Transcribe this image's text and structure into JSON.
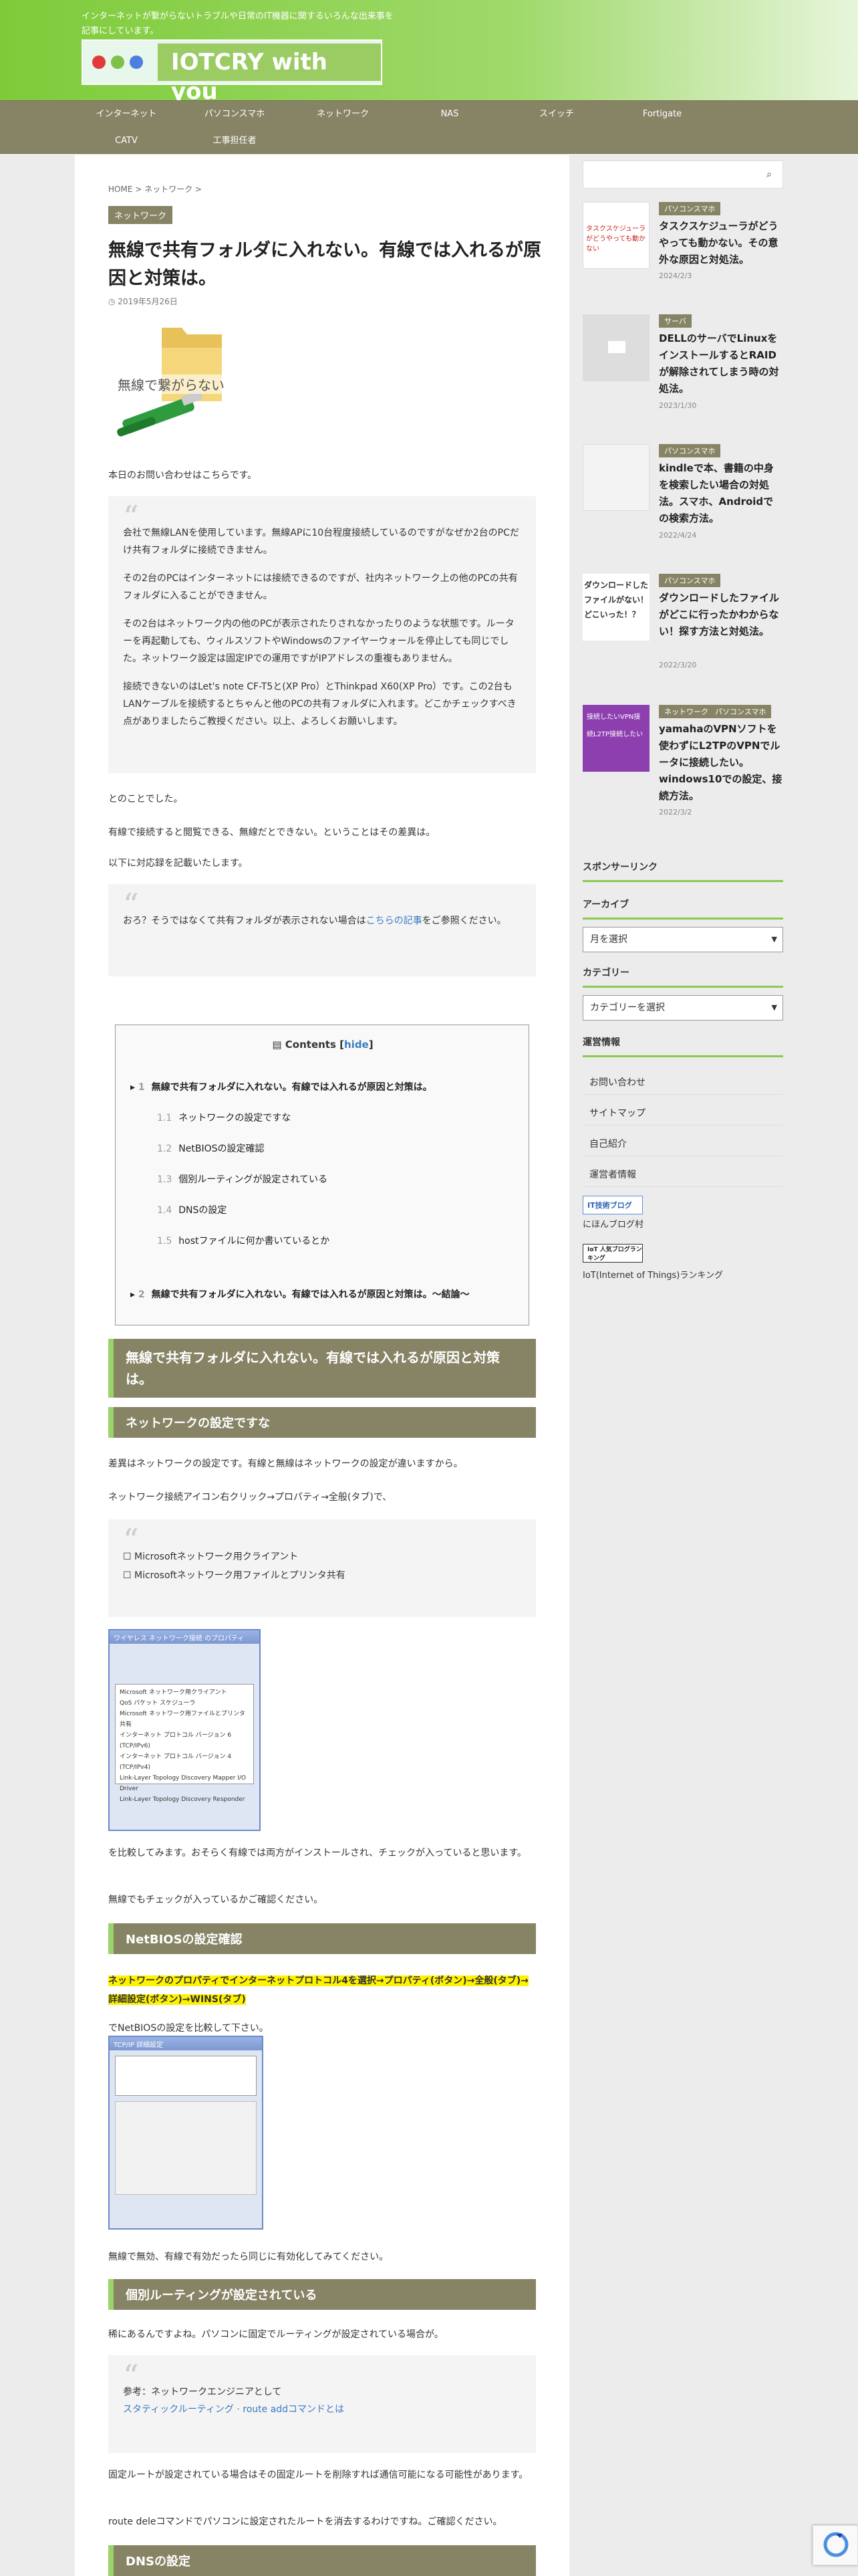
{
  "header": {
    "tagline": "インターネットが繋がらないトラブルや日常のIT機器に関するいろんな出来事を記事にしています。",
    "logo_text": "IOTCRY with you",
    "colors": {
      "dot1": "#e23a3a",
      "dot2": "#7fc04a",
      "dot3": "#4d7fe0",
      "bar": "#878466",
      "accent": "#9bd36a",
      "highlight": "#fff200"
    }
  },
  "nav": {
    "items": [
      "インターネット",
      "パソコンスマホ",
      "ネットワーク",
      "NAS",
      "スイッチ",
      "Fortigate",
      "CATV",
      "工事担任者"
    ]
  },
  "article": {
    "breadcrumb": "HOME > ネットワーク >",
    "category": "ネットワーク",
    "title": "無線で共有フォルダに入れない。有線では入れるが原因と対策は。",
    "date": "2019年5月26日",
    "eyecatch_text": "無線で繋がらない",
    "intro": "本日のお問い合わせはこちらです。",
    "inquiry": [
      "会社で無線LANを使用しています。無線APに10台程度接続しているのですがなぜか2台のPCだけ共有フォルダに接続できません。",
      "その2台のPCはインターネットには接続できるのですが、社内ネットワーク上の他のPCの共有フォルダに入ることができません。",
      "その2台はネットワーク内の他のPCが表示されたりされなかったりのような状態です。ルーターを再起動しても、ウィルスソフトやWindowsのファイヤーウォールを停止しても同じでした。ネットワーク設定は固定IPでの運用ですがIPアドレスの重複もありません。",
      "接続できないのはLet's note CF-T5と(XP Pro）とThinkpad X60(XP Pro）です。この2台もLANケーブルを接続するとちゃんと他のPCの共有フォルダに入れます。どこかチェックすべき点がありましたらご教授ください。以上、よろしくお願いします。"
    ],
    "after1": "とのことでした。",
    "after2": "有線で接続すると閲覧できる、無線だとできない。ということはその差異は。",
    "after3": "以下に対応録を記載いたします。",
    "note_prefix": "おろ？そうではなくて共有フォルダが表示されない場合は",
    "note_link": "こちらの記事",
    "note_suffix": "をご参照ください。",
    "toc": {
      "title": "Contents",
      "hide": "hide",
      "items": [
        {
          "num": "1",
          "label": "無線で共有フォルダに入れない。有線では入れるが原因と対策は。"
        },
        {
          "num": "1.1",
          "label": "ネットワークの設定ですな"
        },
        {
          "num": "1.2",
          "label": "NetBIOSの設定確認"
        },
        {
          "num": "1.3",
          "label": "個別ルーティングが設定されている"
        },
        {
          "num": "1.4",
          "label": "DNSの設定"
        },
        {
          "num": "1.5",
          "label": "hostファイルに何か書いているとか"
        },
        {
          "num": "2",
          "label": "無線で共有フォルダに入れない。有線では入れるが原因と対策は。〜結論〜"
        }
      ]
    },
    "h2": "無線で共有フォルダに入れない。有線では入れるが原因と対策は。",
    "h3_1": "ネットワークの設定ですな",
    "s1_p1": "差異はネットワークの設定です。有線と無線はネットワークの設定が違いますから。",
    "s1_p2": "ネットワーク接続アイコン右クリック→プロパティ→全般(タブ)で、",
    "s1_quote": [
      "☐ Microsoftネットワーク用クライアント",
      "☐ Microsoftネットワーク用ファイルとプリンタ共有"
    ],
    "shot1_title": "ワイヤレス ネットワーク接続 のプロパティ",
    "shot1_lines": [
      "Microsoft ネットワーク用クライアント",
      "QoS パケット スケジューラ",
      "Microsoft ネットワーク用ファイルとプリンタ共有",
      "インターネット プロトコル バージョン 6 (TCP/IPv6)",
      "インターネット プロトコル バージョン 4 (TCP/IPv4)",
      "Link-Layer Topology Discovery Mapper I/O Driver",
      "Link-Layer Topology Discovery Responder"
    ],
    "s1_p3": "を比較してみます。おそらく有線では両方がインストールされ、チェックが入っていると思います。",
    "s1_p4": "無線でもチェックが入っているかご確認ください。",
    "h3_2": "NetBIOSの設定確認",
    "s2_hl": "ネットワークのプロパティでインターネットプロトコル4を選択→プロパティ(ボタン)→全般(タブ)→詳細設定(ボタン)→WINS(タブ)",
    "s2_p1": "でNetBIOSの設定を比較して下さい。",
    "shot2_title": "TCP/IP 詳細設定",
    "s2_p2": "無線で無効、有線で有効だったら同じに有効化してみてください。",
    "h3_3": "個別ルーティングが設定されている",
    "s3_p1": "稀にあるんですよね。パソコンに固定でルーティングが設定されている場合が。",
    "s3_quote_label": "参考：ネットワークエンジニアとして",
    "s3_quote_link": "スタティックルーティング · route addコマンドとは",
    "s3_p2": "固定ルートが設定されている場合はその固定ルートを削除すれば通信可能になる可能性があります。",
    "s3_p3": "route deleコマンドでパソコンに設定されたルートを消去するわけですね。ご確認ください。",
    "h3_4": "DNSの設定"
  },
  "sidebar": {
    "search_icon": "search-icon",
    "posts": [
      {
        "cat": "パソコンスマホ",
        "title": "タスクスケジューラがどうやっても動かない。その意外な原因と対処法。",
        "date": "2024/2/3",
        "thumb": "タスクスケジューラがどうやっても動かない"
      },
      {
        "cat": "サーバ",
        "title": "DELLのサーバでLinuxをインストールするとRAIDが解除されてしまう時の対処法。",
        "date": "2023/1/30",
        "thumb": ""
      },
      {
        "cat": "パソコンスマホ",
        "title": "kindleで本、書籍の中身を検索したい場合の対処法。スマホ、Androidでの検索方法。",
        "date": "2022/4/24",
        "thumb": ""
      },
      {
        "cat": "パソコンスマホ",
        "title": "ダウンロードしたファイルがどこに行ったかわからない！探す方法と対処法。",
        "date": "2022/3/20",
        "thumb": "ダウンロードしたファイルがない！どこいった！？"
      },
      {
        "cat": "ネットワーク",
        "cat2": "パソコンスマホ",
        "title": "yamahaのVPNソフトを使わずにL2TPのVPNでルータに接続したい。windows10での設定、接続方法。",
        "date": "2022/3/2",
        "thumb": "接続したいVPN接続L2TP接続したい"
      }
    ],
    "sponsor": "スポンサーリンク",
    "archive": "アーカイブ",
    "archive_select": "月を選択",
    "category": "カテゴリー",
    "category_select": "カテゴリーを選択",
    "info": "運営情報",
    "info_links": [
      "お問い合わせ",
      "サイトマップ",
      "自己紹介",
      "運営者情報"
    ],
    "blog_badge": "IT技術ブログ",
    "blog_link": "にほんブログ村",
    "rank_badge": "IoT 人気ブログランキング",
    "rank_link": "IoT(Internet of Things)ランキング"
  }
}
